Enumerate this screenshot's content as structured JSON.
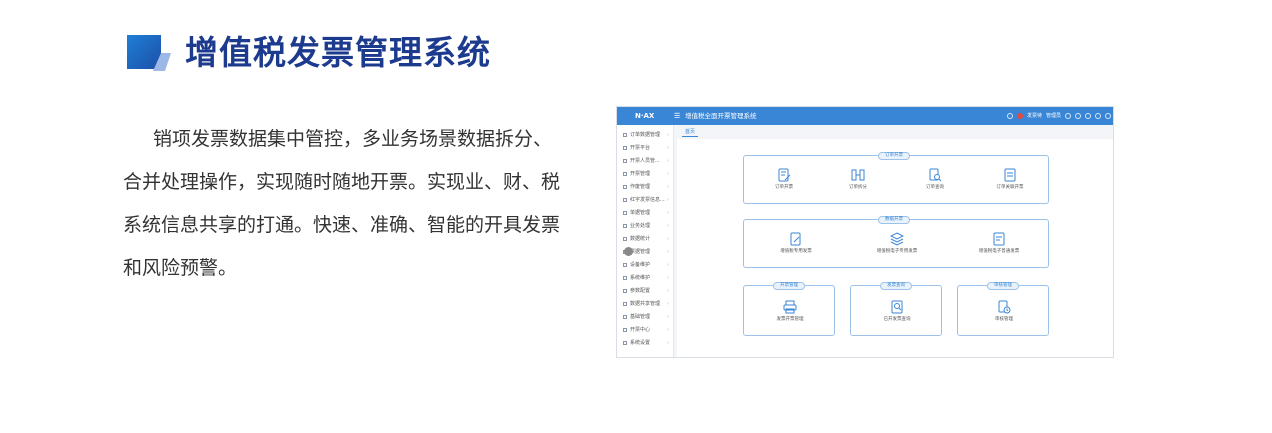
{
  "header": {
    "title": "增值税发票管理系统"
  },
  "description": "销项发票数据集中管控，多业务场景数据拆分、合并处理操作，实现随时随地开票。实现业、财、税系统信息共享的打通。快速、准确、智能的开具发票和风险预警。",
  "app": {
    "logo": "N·AX",
    "title": "增值税全面开票管理系统",
    "topbar_right": [
      "发票待",
      "管理员"
    ],
    "sidebar": [
      "订单数据管理",
      "开票平台",
      "开票人员管...",
      "开票管理",
      "作废管理",
      "红字发票信息...",
      "单据管理",
      "业务处理",
      "数据统计",
      "票据管理",
      "设备维护",
      "系统维护",
      "参数配置",
      "数据共享管理",
      "基础管理",
      "开票中心",
      "系统设置"
    ],
    "tab": "首页",
    "panels": [
      {
        "tag": "订单开票",
        "items": [
          "订单开票",
          "订单拆分",
          "订单查询",
          "订单关联开票"
        ]
      },
      {
        "tag": "数据开票",
        "items": [
          "增值税专用发票",
          "增值税电子专用发票",
          "增值税电子普通发票"
        ]
      },
      {
        "tag": "开票管理",
        "items": [
          "发票开票管理"
        ]
      },
      {
        "tag": "发票查询",
        "items": [
          "已开发票查询"
        ]
      },
      {
        "tag": "审核管理",
        "items": [
          "审核管理"
        ]
      }
    ]
  },
  "colors": {
    "title": "#1c3a8e",
    "accent": "#3a86d6",
    "panel_border": "#9cc2ea"
  }
}
